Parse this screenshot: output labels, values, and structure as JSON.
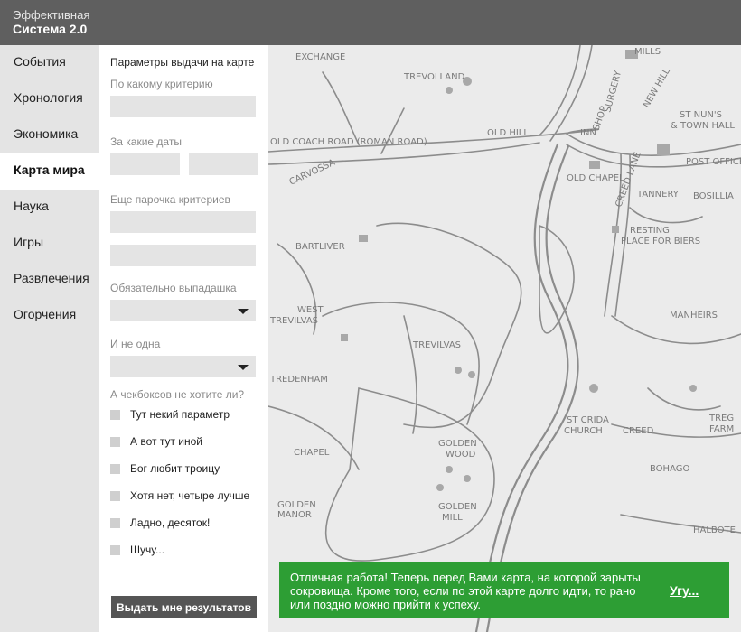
{
  "header": {
    "subtitle": "Эффективная",
    "title": "Система 2.0"
  },
  "sidebar": {
    "items": [
      {
        "label": "События"
      },
      {
        "label": "Хронология"
      },
      {
        "label": "Экономика"
      },
      {
        "label": "Карта мира",
        "active": true
      },
      {
        "label": "Наука"
      },
      {
        "label": "Игры"
      },
      {
        "label": "Развлечения"
      },
      {
        "label": "Огорчения"
      }
    ]
  },
  "panel": {
    "title": "Параметры выдачи на карте",
    "criterion_label": "По какому критерию",
    "criterion_value": "",
    "dates_label": "За какие даты",
    "date_from": "",
    "date_to": "",
    "more_label": "Еще парочка критериев",
    "more_value_1": "",
    "more_value_2": "",
    "dropdown_label": "Обязательно выпадашка",
    "dropdown_value": "",
    "dropdown2_label": "И не одна",
    "dropdown2_value": "",
    "checkbox_label": "А чекбоксов не хотите ли?",
    "checkboxes": [
      {
        "label": "Тут некий параметр",
        "checked": false
      },
      {
        "label": "А вот тут иной",
        "checked": false
      },
      {
        "label": "Бог любит троицу",
        "checked": false
      },
      {
        "label": "Хотя нет, четыре лучше",
        "checked": false
      },
      {
        "label": "Ладно, десяток!",
        "checked": false
      },
      {
        "label": "Шучу...",
        "checked": false
      }
    ],
    "submit_label": "Выдать мне результатов"
  },
  "map": {
    "labels": {
      "exchange": "EXCHANGE",
      "trevolland": "TREVOLLAND",
      "mills": "MILLS",
      "surgery": "SURGERY",
      "new_hill": "NEW HILL",
      "st_nuns": "ST NUN'S",
      "town_hall": "& TOWN HALL",
      "old_hill": "OLD HILL",
      "inn": "INN",
      "shop": "SHOP",
      "coach_road": "OLD COACH ROAD (ROMAN ROAD)",
      "post_office": "POST OFFICE",
      "carvossa": "CARVOSSA",
      "old_chapel": "OLD CHAPEL",
      "creed_lane": "CREED LANE",
      "tannery": "TANNERY",
      "bosilliack": "BOSILLIA",
      "resting": "RESTING",
      "place_biers": "PLACE FOR BIERS",
      "bartliver": "BARTLIVER",
      "west": "WEST",
      "trevilvas_w": "TREVILVAS",
      "manheirs": "MANHEIRS",
      "trevilvas": "TREVILVAS",
      "tredenham": "TREDENHAM",
      "st_crida": "ST CRIDA",
      "church": "CHURCH",
      "creed": "CREED",
      "trego": "TREG",
      "farm": "FARM",
      "chapel": "CHAPEL",
      "golden_wood": "GOLDEN",
      "wood": "WOOD",
      "bohago": "BOHAGO",
      "golden_manor": "GOLDEN",
      "manor": "MANOR",
      "golden_mill": "GOLDEN",
      "mill": "MILL",
      "halbote": "HALBOTE"
    }
  },
  "toast": {
    "message": "Отличная работа! Теперь перед Вами карта, на которой зарыты сокровища. Кроме того, если по этой карте долго идти, то рано или поздно можно прийти к успеху.",
    "action": "Угу..."
  }
}
